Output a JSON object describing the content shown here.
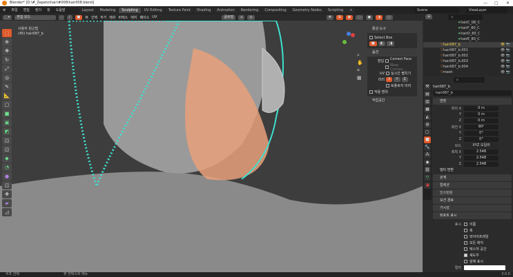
{
  "title": "Blender* [D:\\#_Zepeto\\hair\\#008\\hair008.blend]",
  "menus": [
    "파일",
    "편집",
    "렌더",
    "창",
    "도움말"
  ],
  "workspaces": [
    "Layout",
    "Modeling",
    "Sculpting",
    "UV Editing",
    "Texture Paint",
    "Shading",
    "Animation",
    "Rendering",
    "Compositing",
    "Geometry Nodes",
    "Scripting",
    "+"
  ],
  "active_workspace": "Sculpting",
  "scene": "Scene",
  "view_layer": "ViewLayer",
  "header": {
    "mode": "편집 모드",
    "menus": [
      "뷰",
      "선택",
      "추가",
      "메쉬",
      "버텍스",
      "에지",
      "페이스",
      "UV"
    ],
    "orientation": "글로벌"
  },
  "viewport": {
    "view_name": "사용자 원근법",
    "object_info": "(45) hair087_b"
  },
  "npanel": {
    "active_tool_header": "활성 도구",
    "tool_name": "Select Box",
    "options_header": "옵션",
    "edit_label": "편집",
    "correct_face": "Correct Face ...",
    "keep_connected": "Keep Connec...",
    "uv_label": "UV",
    "live_unwrap": "실시간 펼치기",
    "mirror_label": "미러",
    "axes": [
      "X",
      "Y",
      "Z"
    ],
    "topology_mirror": "토폴로지 미러",
    "transform_affect": "작용 범위",
    "workspace_header": "작업공간"
  },
  "outliner": {
    "items": [
      {
        "name": "hairC_08_C",
        "type": "bone",
        "selected": false
      },
      {
        "name": "hairF_80_C",
        "type": "bone",
        "selected": false
      },
      {
        "name": "hairD_80_C",
        "type": "bone",
        "selected": false
      },
      {
        "name": "hairE_80_C",
        "type": "bone",
        "selected": false
      },
      {
        "name": "hair087_b",
        "type": "mesh",
        "selected": true
      },
      {
        "name": "hair087_b.001",
        "type": "mesh",
        "selected": false
      },
      {
        "name": "hair087_b.002",
        "type": "mesh",
        "selected": false
      },
      {
        "name": "hair087_b.003",
        "type": "mesh",
        "selected": false
      },
      {
        "name": "hair087_b.004",
        "type": "mesh",
        "selected": false
      },
      {
        "name": "mesh",
        "type": "mesh",
        "selected": false
      }
    ]
  },
  "properties": {
    "object_name": "hair087_b",
    "data_name": "hair087_b",
    "transform_header": "변환",
    "location": {
      "label": "위치 X",
      "x": "0 m",
      "y": "0 m",
      "z": "0 m"
    },
    "rotation": {
      "label": "회전 X",
      "x": "90°",
      "y": "0°",
      "z": "0°"
    },
    "mode_label": "모드",
    "mode_value": "XYZ 오일러",
    "scale": {
      "label": "축척 X",
      "x": "2.548",
      "y": "2.548",
      "z": "2.548"
    },
    "delta": "델타 변환",
    "sections": [
      "관계",
      "컬렉션",
      "인스턴싱",
      "모션 경로",
      "가시성"
    ],
    "viewport_display": "뷰포트 표시",
    "show_label": "표시",
    "show_options": [
      {
        "label": "이름",
        "checked": false
      },
      {
        "label": "축",
        "checked": false
      },
      {
        "label": "와이어프레임",
        "checked": false
      },
      {
        "label": "모든 에지",
        "checked": false
      },
      {
        "label": "텍스처 공간",
        "checked": false
      },
      {
        "label": "섀도우",
        "checked": true
      },
      {
        "label": "앞에 표시",
        "checked": false
      }
    ],
    "color_label": "컬러",
    "Y": "Y",
    "Z": "Z"
  },
  "status": {
    "left": "루프 선택",
    "middle": "뷰 컨텍스트 메뉴",
    "version": "3.0.0"
  },
  "colors": {
    "accent": "#e05a2b",
    "selected_text": "#ffd44a",
    "wire": "#3fe0d0",
    "face": "#e8a07a"
  }
}
